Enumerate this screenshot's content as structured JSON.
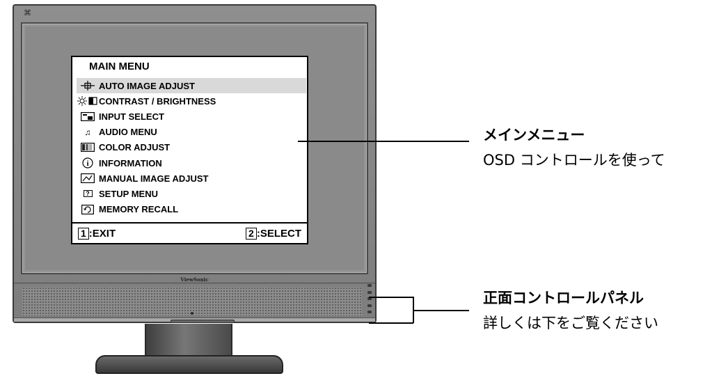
{
  "monitor": {
    "brand": "ViewSonic"
  },
  "osd": {
    "title": "MAIN MENU",
    "items": [
      {
        "label": "AUTO IMAGE ADJUST",
        "icon": "crosshair-icon",
        "selected": true
      },
      {
        "label": "CONTRAST / BRIGHTNESS",
        "icon": "sun-contrast-icon",
        "selected": false
      },
      {
        "label": "INPUT SELECT",
        "icon": "input-select-icon",
        "selected": false
      },
      {
        "label": "AUDIO MENU",
        "icon": "music-note-icon",
        "selected": false
      },
      {
        "label": "COLOR ADJUST",
        "icon": "color-bars-icon",
        "selected": false
      },
      {
        "label": "INFORMATION",
        "icon": "info-icon",
        "selected": false
      },
      {
        "label": "MANUAL IMAGE ADJUST",
        "icon": "manual-image-icon",
        "selected": false
      },
      {
        "label": "SETUP MENU",
        "icon": "question-icon",
        "selected": false
      },
      {
        "label": "MEMORY RECALL",
        "icon": "memory-recall-icon",
        "selected": false
      }
    ],
    "footer": {
      "exit_key": "1",
      "exit_label": ":EXIT",
      "select_key": "2",
      "select_label": ":SELECT"
    }
  },
  "callouts": {
    "main_menu": {
      "heading": "メインメニュー",
      "text": "OSD コントロールを使って"
    },
    "front_panel": {
      "heading": "正面コントロールパネル",
      "text": "詳しくは下をご覧ください"
    }
  }
}
